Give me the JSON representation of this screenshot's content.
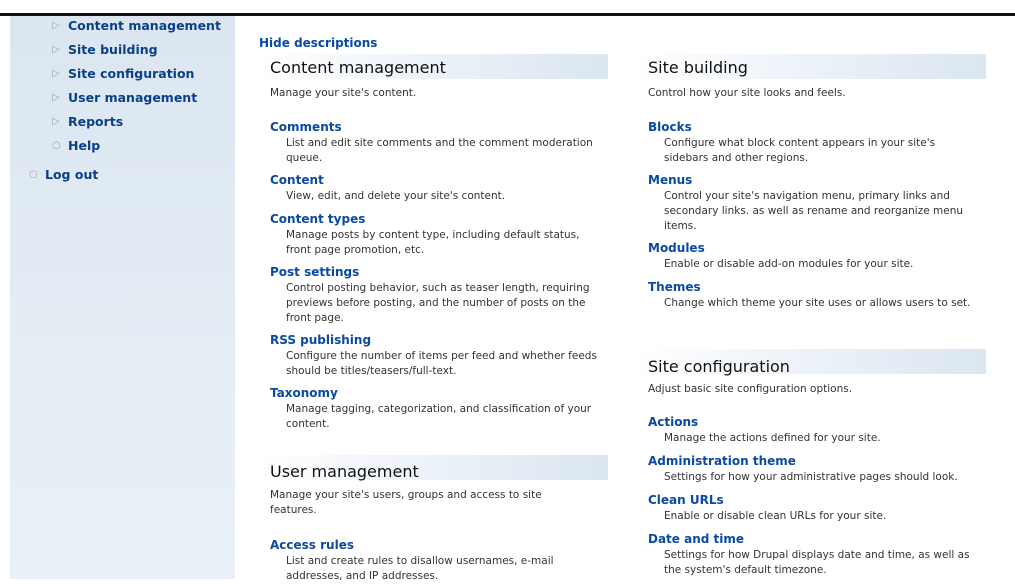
{
  "sidebar": {
    "items": [
      {
        "label": "Content management",
        "bullet": "▷"
      },
      {
        "label": "Site building",
        "bullet": "▷"
      },
      {
        "label": "Site configuration",
        "bullet": "▷"
      },
      {
        "label": "User management",
        "bullet": "▷"
      },
      {
        "label": "Reports",
        "bullet": "▷"
      },
      {
        "label": "Help",
        "bullet": "○"
      }
    ],
    "logout": {
      "label": "Log out",
      "bullet": "○"
    }
  },
  "main": {
    "hide_descriptions": "Hide descriptions",
    "panels": {
      "content_management": {
        "title": "Content management",
        "description": "Manage your site's content.",
        "items": [
          {
            "label": "Comments",
            "description": "List and edit site comments and the comment moderation queue."
          },
          {
            "label": "Content",
            "description": "View, edit, and delete your site's content."
          },
          {
            "label": "Content types",
            "description": "Manage posts by content type, including default status, front page promotion, etc."
          },
          {
            "label": "Post settings",
            "description": "Control posting behavior, such as teaser length, requiring previews before posting, and the number of posts on the front page."
          },
          {
            "label": "RSS publishing",
            "description": "Configure the number of items per feed and whether feeds should be titles/teasers/full-text."
          },
          {
            "label": "Taxonomy",
            "description": "Manage tagging, categorization, and classification of your content."
          }
        ]
      },
      "user_management": {
        "title": "User management",
        "description": "Manage your site's users, groups and access to site features.",
        "items": [
          {
            "label": "Access rules",
            "description": "List and create rules to disallow usernames, e-mail addresses, and IP addresses."
          }
        ]
      },
      "site_building": {
        "title": "Site building",
        "description": "Control how your site looks and feels.",
        "items": [
          {
            "label": "Blocks",
            "description": "Configure what block content appears in your site's sidebars and other regions."
          },
          {
            "label": "Menus",
            "description": "Control your site's navigation menu, primary links and secondary links. as well as rename and reorganize menu items."
          },
          {
            "label": "Modules",
            "description": "Enable or disable add-on modules for your site."
          },
          {
            "label": "Themes",
            "description": "Change which theme your site uses or allows users to set."
          }
        ]
      },
      "site_configuration": {
        "title": "Site configuration",
        "description": "Adjust basic site configuration options.",
        "items": [
          {
            "label": "Actions",
            "description": "Manage the actions defined for your site."
          },
          {
            "label": "Administration theme",
            "description": "Settings for how your administrative pages should look."
          },
          {
            "label": "Clean URLs",
            "description": "Enable or disable clean URLs for your site."
          },
          {
            "label": "Date and time",
            "description": "Settings for how Drupal displays date and time, as well as the system's default timezone."
          }
        ]
      }
    }
  }
}
